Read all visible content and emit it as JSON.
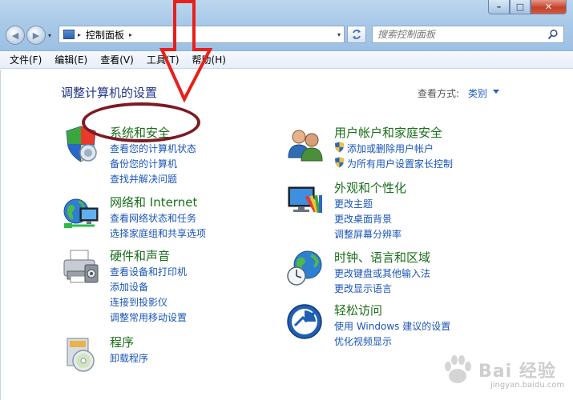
{
  "window": {
    "min_glyph": "–",
    "max_glyph": "□",
    "close_glyph": "✕"
  },
  "address_bar": {
    "path": "控制面板",
    "separator": "▸",
    "dropdown_glyph": "▾"
  },
  "search": {
    "placeholder": "搜索控制面板"
  },
  "menu": {
    "items": [
      "文件(F)",
      "编辑(E)",
      "查看(V)",
      "工具(T)",
      "帮助(H)"
    ]
  },
  "page": {
    "title": "调整计算机的设置",
    "view_by_label": "查看方式:",
    "view_by_value": "类别"
  },
  "categories": [
    {
      "title": "系统和安全",
      "links": [
        "查看您的计算机状态",
        "备份您的计算机",
        "查找并解决问题"
      ]
    },
    {
      "title": "网络和 Internet",
      "links": [
        "查看网络状态和任务",
        "选择家庭组和共享选项"
      ]
    },
    {
      "title": "硬件和声音",
      "links": [
        "查看设备和打印机",
        "添加设备",
        "连接到投影仪",
        "调整常用移动设置"
      ]
    },
    {
      "title": "程序",
      "links": [
        "卸载程序"
      ]
    },
    {
      "title": "用户帐户和家庭安全",
      "links": [
        "添加或删除用户帐户",
        "为所有用户设置家长控制"
      ]
    },
    {
      "title": "外观和个性化",
      "links": [
        "更改主题",
        "更改桌面背景",
        "调整屏幕分辨率"
      ]
    },
    {
      "title": "时钟、语言和区域",
      "links": [
        "更改键盘或其他输入法",
        "更改显示语言"
      ]
    },
    {
      "title": "轻松访问",
      "links": [
        "使用 Windows 建议的设置",
        "优化视频显示"
      ]
    }
  ],
  "watermark": {
    "brand": "Bai 经验",
    "url": "jingyan.baidu.com"
  },
  "colors": {
    "category_title": "#1a6e1a",
    "link": "#1a55b8",
    "annotation_arrow": "#e8201a",
    "annotation_ellipse": "#7d1a22"
  }
}
